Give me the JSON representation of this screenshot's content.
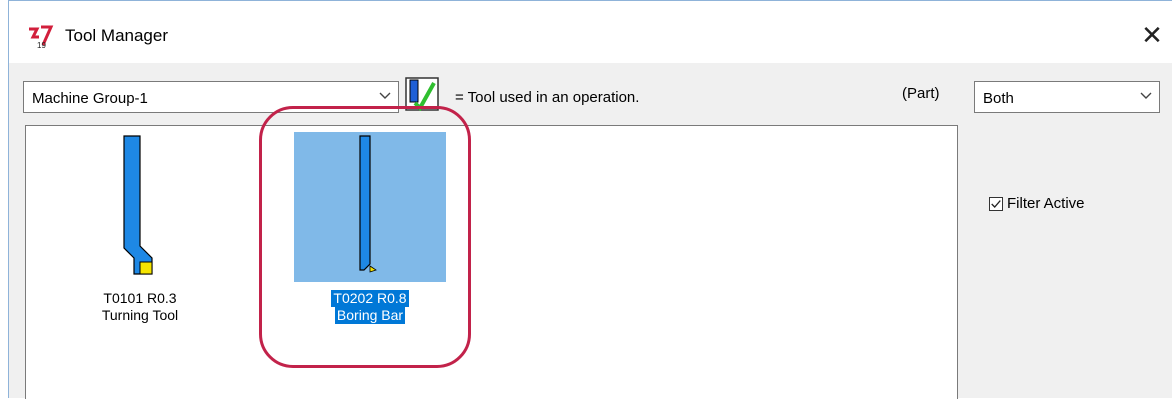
{
  "window": {
    "title": "Tool Manager",
    "app_icon": "mastercam-logo-icon",
    "close_icon": "close-icon"
  },
  "toolbar": {
    "machine_group": "Machine Group-1",
    "legend_text": "= Tool used in an operation.",
    "legend_icon": "tool-used-icon",
    "part_label": "(Part)",
    "filter_mode": "Both"
  },
  "tools": [
    {
      "line1": "T0101 R0.3",
      "line2": "Turning Tool",
      "selected": false,
      "icon": "turning-tool-icon"
    },
    {
      "line1": "T0202 R0.8",
      "line2": "Boring Bar",
      "selected": true,
      "icon": "boring-bar-icon"
    }
  ],
  "filter": {
    "label": "Filter Active",
    "checked": true
  },
  "colors": {
    "tool_body": "#1e88e5",
    "tool_outline": "#000000",
    "insert": "#f5e400",
    "selection": "#0078d7",
    "highlight_ring": "#c2224a"
  }
}
